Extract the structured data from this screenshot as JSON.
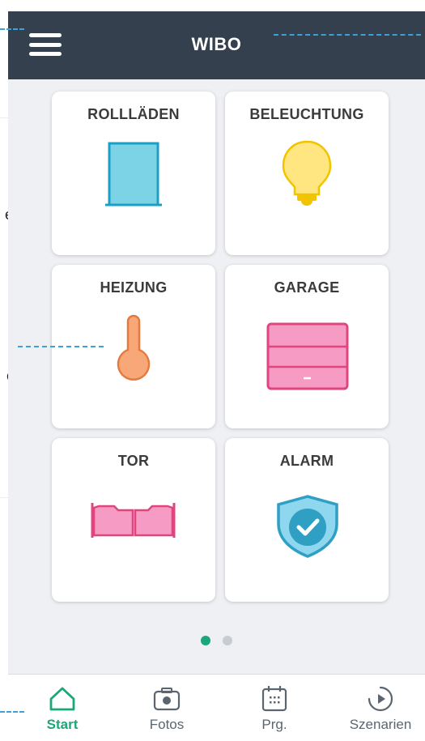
{
  "app": {
    "title": "WIBO"
  },
  "background": {
    "char_1": "e,",
    "char_2": "e"
  },
  "tiles": [
    {
      "label": "ROLLLÄDEN",
      "icon": "roller-shutter-icon"
    },
    {
      "label": "BELEUCHTUNG",
      "icon": "light-bulb-icon"
    },
    {
      "label": "HEIZUNG",
      "icon": "thermometer-icon"
    },
    {
      "label": "GARAGE",
      "icon": "garage-door-icon"
    },
    {
      "label": "TOR",
      "icon": "gate-icon"
    },
    {
      "label": "ALARM",
      "icon": "shield-check-icon"
    }
  ],
  "pagination": {
    "pages": 2,
    "active": 1
  },
  "nav": [
    {
      "label": "Start",
      "icon": "home-icon",
      "active": true
    },
    {
      "label": "Fotos",
      "icon": "camera-icon",
      "active": false
    },
    {
      "label": "Prg.",
      "icon": "calendar-icon",
      "active": false
    },
    {
      "label": "Szenarien",
      "icon": "play-circle-icon",
      "active": false
    }
  ],
  "colors": {
    "topbar": "#34404d",
    "accent": "#1aa77a",
    "callout": "#3aa2d8",
    "shutter": "#7dd3e6",
    "bulb": "#ffe680",
    "thermo": "#f8a878",
    "garage": "#f59bc4",
    "alarm": "#2f9fc4"
  }
}
